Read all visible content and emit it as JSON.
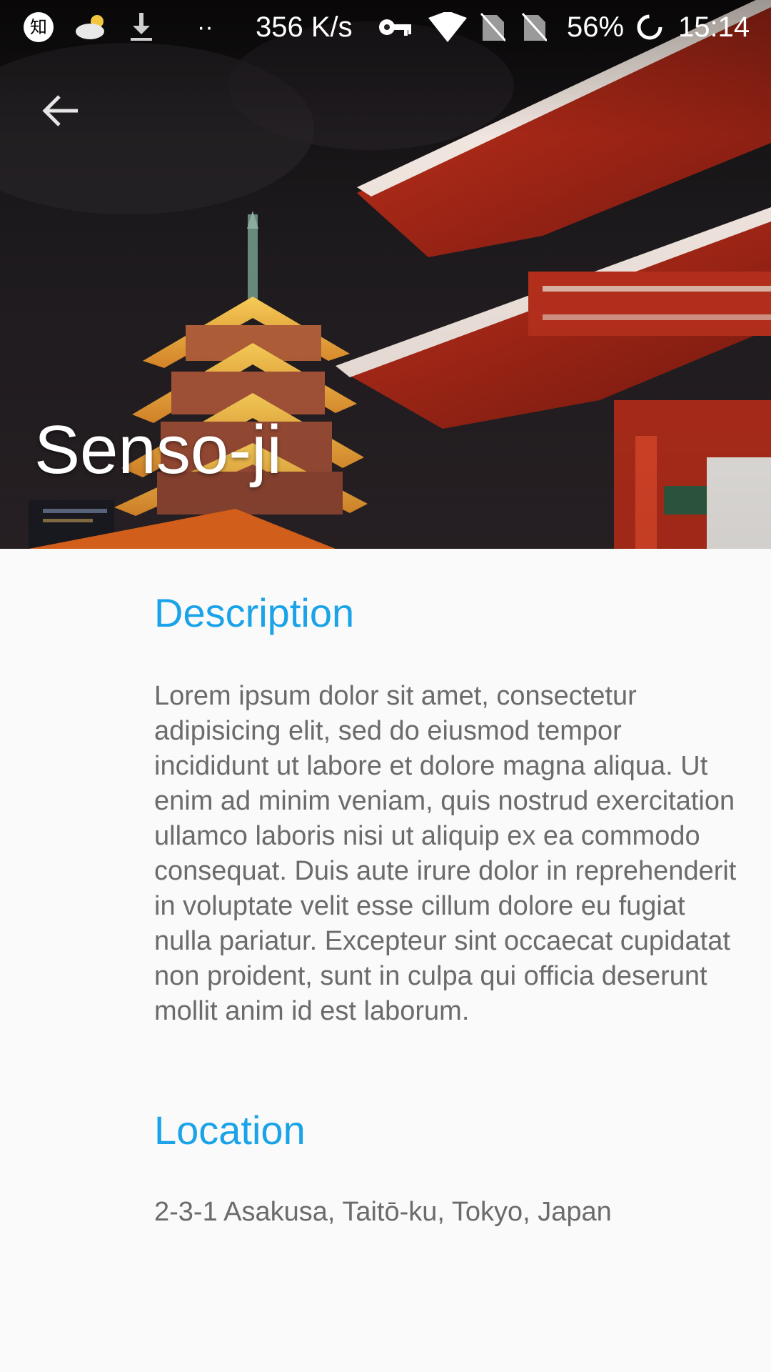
{
  "status_bar": {
    "notification_icons": [
      "zhihu-icon",
      "cloud-weather-icon",
      "download-icon"
    ],
    "more_indicator": "··",
    "network_speed": "356 K/s",
    "system_icons": [
      "key-icon",
      "wifi-icon",
      "no-sim-icon",
      "no-sim-icon"
    ],
    "battery_percent": "56%",
    "time": "15:14"
  },
  "app_bar": {
    "back_icon": "arrow-back-icon",
    "title": "Senso-ji"
  },
  "sections": {
    "description": {
      "heading": "Description",
      "body": "Lorem ipsum dolor sit amet, consectetur adipisicing elit, sed do eiusmod tempor incididunt ut labore et dolore magna aliqua. Ut enim ad minim veniam, quis nostrud exercitation ullamco laboris nisi ut aliquip ex ea commodo consequat. Duis aute irure dolor in reprehenderit in voluptate velit esse cillum dolore eu fugiat nulla pariatur. Excepteur sint occaecat cupidatat non proident, sunt in culpa qui officia deserunt mollit anim id est laborum."
    },
    "location": {
      "heading": "Location",
      "address": "2-3-1 Asakusa, Taitō-ku, Tokyo, Japan"
    }
  },
  "colors": {
    "accent": "#1aa3e8",
    "body_text": "#6b6b6b",
    "background": "#fafafa"
  }
}
